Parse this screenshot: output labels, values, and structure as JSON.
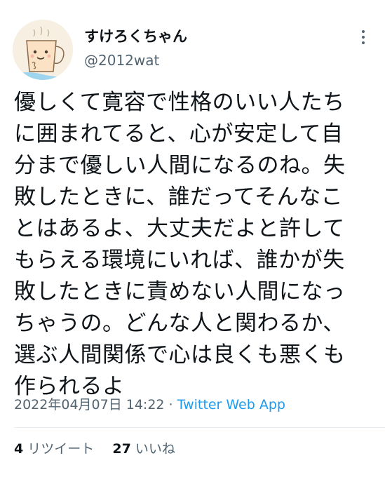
{
  "author": {
    "display_name": "すけろくちゃん",
    "handle": "@2012wat"
  },
  "tweet": {
    "lines": [
      "優しくて寛容で性格のいい人たち",
      "に囲まれてると、心が安定して自",
      "分まで優しい人間になるのね。失",
      "敗したときに、誰だってそんなこ",
      "とはあるよ、大丈夫だよと許して",
      "もらえる環境にいれば、誰かが失",
      "敗したときに責めない人間になっ",
      "ちゃうの。どんな人と関わるか、",
      "選ぶ人間関係で心は良くも悪くも",
      "作られるよ"
    ],
    "timestamp": "2022年04月07日 14:22",
    "separator": " · ",
    "source": "Twitter Web App"
  },
  "stats": {
    "retweets_count": "4",
    "retweets_label": "リツイート",
    "likes_count": "27",
    "likes_label": "いいね"
  },
  "icons": {
    "more": "more-options-icon",
    "avatar": "mug-character-avatar"
  },
  "colors": {
    "text_primary": "#0f1419",
    "text_secondary": "#536471",
    "link": "#1d9bf0",
    "divider": "#e6ecf0"
  }
}
